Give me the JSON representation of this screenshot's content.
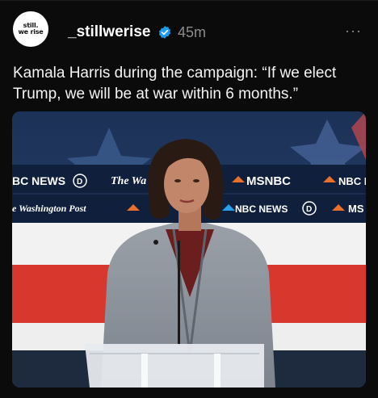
{
  "post": {
    "avatar_text_line1": "still.",
    "avatar_text_line2": "we rise",
    "username": "_stillwerise",
    "timestamp": "45m",
    "more_label": "···",
    "caption": "Kamala Harris during the campaign: “If we elect Trump, we will be at war within 6 months.”"
  },
  "media": {
    "overlay_texts": {
      "bc_news": "BC NEWS",
      "the_wa": "The Wa",
      "msnbc": "MSNBC",
      "nbc_n": "NBC N",
      "washington_post": "e Washington Post",
      "nbc_news": "NBC NEWS",
      "ms": "MS"
    }
  },
  "colors": {
    "background": "#0b0b0b",
    "verified_badge": "#1d9bf0",
    "muted_text": "#8c8c8c"
  },
  "icons": {
    "verified": "verified-badge-icon",
    "more": "more-options-icon"
  }
}
